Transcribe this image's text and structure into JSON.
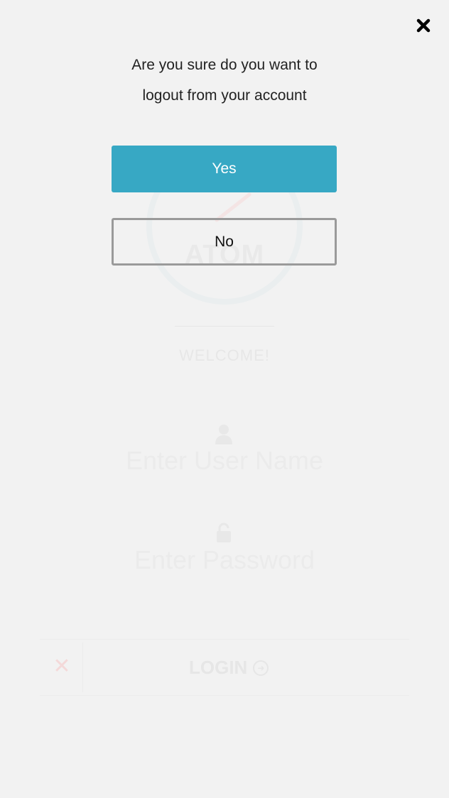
{
  "dialog": {
    "message_line1": "Are you sure do you want to",
    "message_line2": "logout from your account",
    "yes_label": "Yes",
    "no_label": "No",
    "close_icon": "close-icon"
  },
  "background": {
    "logo_text": "ATOM",
    "welcome": "WELCOME!",
    "username_placeholder": "Enter User Name",
    "password_placeholder": "Enter Password",
    "login_label": "LOGIN",
    "cancel_icon": "cancel-icon",
    "user_icon": "user-icon",
    "lock_icon": "lock-icon"
  },
  "colors": {
    "accent": "#37a8c4",
    "background": "#f2f2f2",
    "no_border": "#9a9a9a"
  }
}
